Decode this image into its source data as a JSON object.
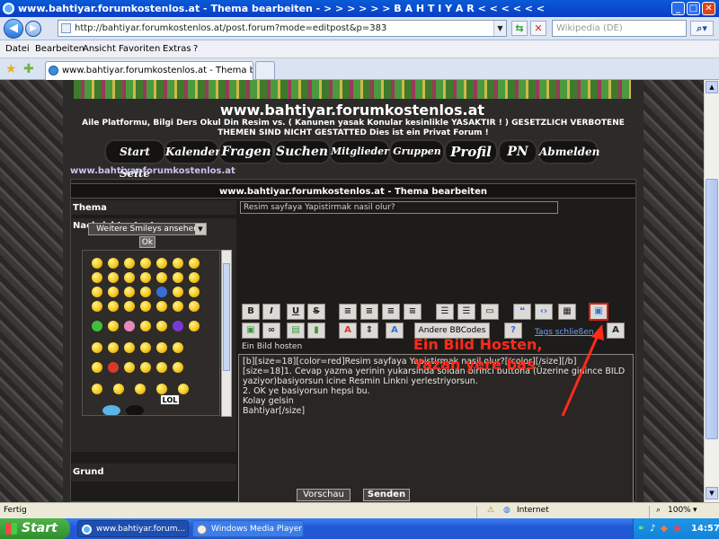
{
  "window": {
    "title": "www.bahtiyar.forumkostenlos.at - Thema bearbeiten - > > > > > >     B A H T I Y A R     < < < < < <",
    "btn_min": "_",
    "btn_max": "□",
    "btn_close": "✕"
  },
  "browser": {
    "url": "http://bahtiyar.forumkostenlos.at/post.forum?mode=editpost&p=383",
    "search_placeholder": "Wikipedia (DE)",
    "menu": [
      "Datei",
      "Bearbeiten",
      "Ansicht",
      "Favoriten",
      "Extras",
      "?"
    ],
    "tab_title": "www.bahtiyar.forumkostenlos.at - Thema bearbeiten",
    "icons": [
      "back-icon",
      "forward-icon",
      "refresh-icon",
      "stop-icon",
      "search-icon",
      "favorites-star-icon",
      "add-favorite-icon"
    ]
  },
  "site": {
    "title": "www.bahtiyar.forumkostenlos.at",
    "slogan": "Aile Platformu, Bilgi Ders Okul Din Resim vs. ( Kanunen yasak Konular kesinlikle YASAKTIR ! ) GESETZLICH VERBOTENE THEMEN SIND NICHT GESTATTED Dies ist ein Privat Forum !",
    "nav": [
      "Start Seite",
      "Kalender",
      "Fragen",
      "Suchen",
      "Mitglieder",
      "Gruppen",
      "Profil",
      "PN",
      "Abmelden"
    ],
    "link": "www.bahtiyar.forumkostenlos.at"
  },
  "form": {
    "header": "www.bahtiyar.forumkostenlos.at - Thema bearbeiten",
    "thema_label": "Thema",
    "thema_value": "Resim sayfaya Yapistirmak nasil olur?",
    "nachricht_label": "Nachrichtentext",
    "smiley_select": "Weitere Smileys ansehen",
    "ok_label": "Ok",
    "bbcodes_label": "Andere BBCodes",
    "tags_close": "Tags schließen",
    "bild_hosten": "Ein Bild hosten",
    "message_lines": [
      "[b][size=18][color=red]Resim sayfaya Yapistirmak nasil olur?[/color][/size][/b]",
      "",
      "",
      "[size=18]1. Cevap yazma yerinin yukarsinda soldan birinci buttona (Üzerine gidince BILD yaziyor)basiyorsun icine Resmin Linkni yerlestriyorsun.",
      "",
      "2. OK ye basiyorsun hepsi bu.",
      "",
      "",
      "Kolay gelsin",
      "",
      "Bahtiyar[/size]"
    ],
    "annotation": [
      "Ein Bild Hosten,",
      "Yazan yere bas"
    ],
    "grund_label": "Grund",
    "preview_btn": "Vorschau",
    "send_btn": "Senden",
    "toolbar_row1": [
      "B",
      "I",
      "U",
      "S"
    ],
    "toolbar_row2_letter": "A",
    "lol_sign": "LOL"
  },
  "status": {
    "left": "Fertig",
    "zone": "Internet",
    "zoom": "100%"
  },
  "taskbar": {
    "start": "Start",
    "items": [
      "www.bahtiyar.forum...",
      "Windows Media Player"
    ],
    "clock": "14:57"
  },
  "colors": {
    "annotation": "#ff2a1a",
    "sitelink": "#c9c2ef",
    "title_bar": "#0a4ecf",
    "taskbar": "#245ddb",
    "start": "#3aa234"
  }
}
